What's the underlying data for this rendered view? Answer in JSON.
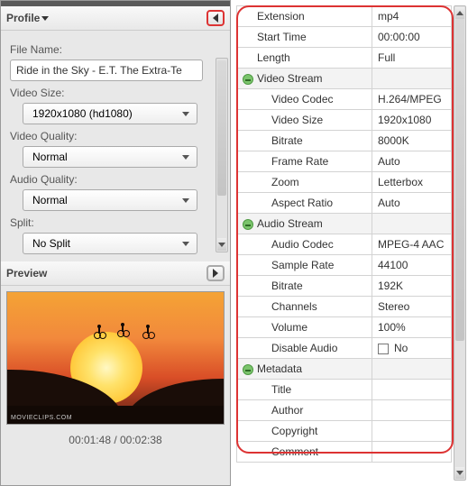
{
  "left": {
    "profile_header": "Profile",
    "labels": {
      "file_name": "File Name:",
      "video_size": "Video Size:",
      "video_quality": "Video Quality:",
      "audio_quality": "Audio Quality:",
      "split": "Split:"
    },
    "values": {
      "file_name": "Ride in the Sky - E.T. The Extra-Te",
      "video_size": "1920x1080 (hd1080)",
      "video_quality": "Normal",
      "audio_quality": "Normal",
      "split": "No Split"
    },
    "preview_header": "Preview",
    "watermark": "MOVIECLIPS.COM",
    "time": "00:01:48 / 00:02:38"
  },
  "right": {
    "rows": [
      {
        "type": "kv",
        "indent": 1,
        "label": "Extension",
        "value": "mp4"
      },
      {
        "type": "kv",
        "indent": 1,
        "label": "Start Time",
        "value": "00:00:00"
      },
      {
        "type": "kv",
        "indent": 1,
        "label": "Length",
        "value": "Full"
      },
      {
        "type": "group",
        "label": "Video Stream"
      },
      {
        "type": "kv",
        "indent": 2,
        "label": "Video Codec",
        "value": "H.264/MPEG"
      },
      {
        "type": "kv",
        "indent": 2,
        "label": "Video Size",
        "value": "1920x1080"
      },
      {
        "type": "kv",
        "indent": 2,
        "label": "Bitrate",
        "value": "8000K"
      },
      {
        "type": "kv",
        "indent": 2,
        "label": "Frame Rate",
        "value": "Auto"
      },
      {
        "type": "kv",
        "indent": 2,
        "label": "Zoom",
        "value": "Letterbox"
      },
      {
        "type": "kv",
        "indent": 2,
        "label": "Aspect Ratio",
        "value": "Auto"
      },
      {
        "type": "group",
        "label": "Audio Stream"
      },
      {
        "type": "kv",
        "indent": 2,
        "label": "Audio Codec",
        "value": "MPEG-4 AAC"
      },
      {
        "type": "kv",
        "indent": 2,
        "label": "Sample Rate",
        "value": "44100"
      },
      {
        "type": "kv",
        "indent": 2,
        "label": "Bitrate",
        "value": "192K"
      },
      {
        "type": "kv",
        "indent": 2,
        "label": "Channels",
        "value": "Stereo"
      },
      {
        "type": "kv",
        "indent": 2,
        "label": "Volume",
        "value": "100%"
      },
      {
        "type": "check",
        "indent": 2,
        "label": "Disable Audio",
        "value": "No"
      },
      {
        "type": "group",
        "label": "Metadata"
      },
      {
        "type": "kv",
        "indent": 2,
        "label": "Title",
        "value": ""
      },
      {
        "type": "kv",
        "indent": 2,
        "label": "Author",
        "value": ""
      },
      {
        "type": "kv",
        "indent": 2,
        "label": "Copyright",
        "value": ""
      },
      {
        "type": "kv",
        "indent": 2,
        "label": "Comment",
        "value": ""
      }
    ]
  }
}
